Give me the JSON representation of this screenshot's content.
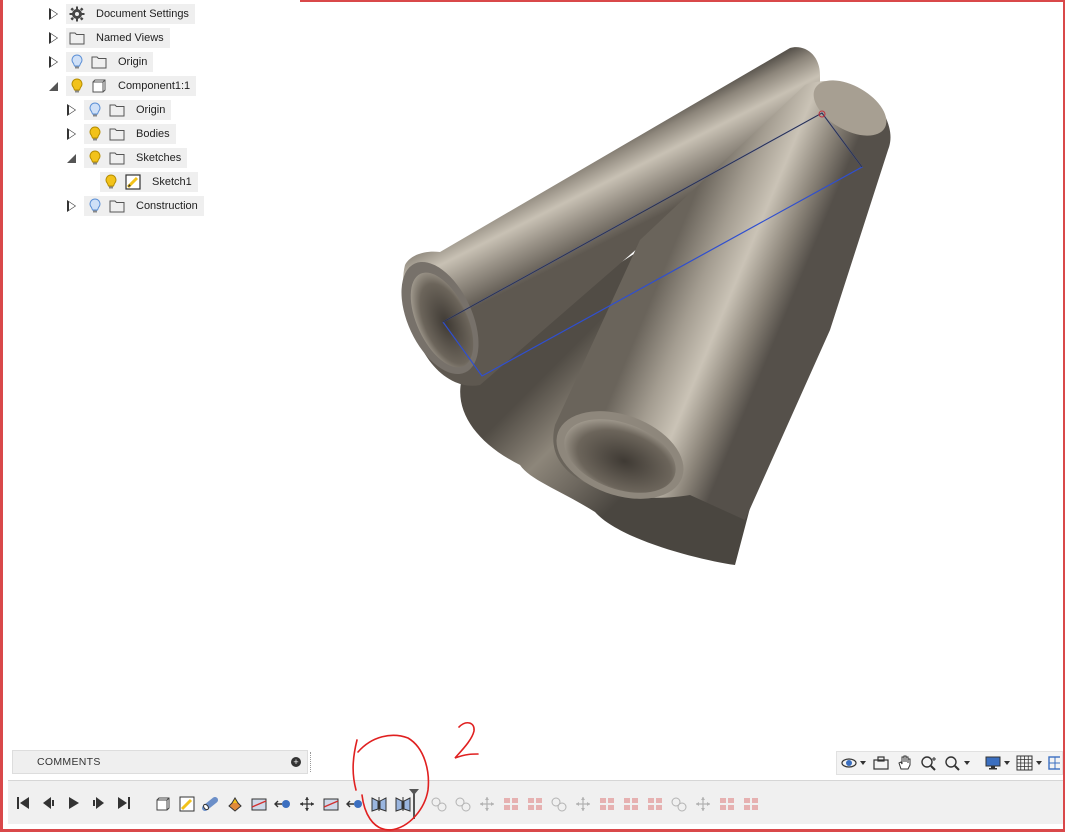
{
  "browser": {
    "items": [
      {
        "label": "Document Settings",
        "icon": "gear-icon"
      },
      {
        "label": "Named Views",
        "icon": "folder-icon"
      },
      {
        "label": "Origin",
        "icon": "folder-icon",
        "visibility": "lightbulb-off-icon"
      },
      {
        "label": "Component1:1",
        "icon": "component-icon",
        "visibility": "lightbulb-on-icon"
      },
      {
        "label": "Origin",
        "icon": "folder-icon",
        "visibility": "lightbulb-off-icon"
      },
      {
        "label": "Bodies",
        "icon": "folder-icon",
        "visibility": "lightbulb-on-icon"
      },
      {
        "label": "Sketches",
        "icon": "folder-icon",
        "visibility": "lightbulb-on-icon"
      },
      {
        "label": "Sketch1",
        "icon": "sketch-icon",
        "visibility": "lightbulb-on-icon"
      },
      {
        "label": "Construction",
        "icon": "folder-icon",
        "visibility": "lightbulb-off-icon"
      }
    ]
  },
  "comments": {
    "label": "COMMENTS"
  },
  "annotations": {
    "one": "1",
    "two": "2"
  },
  "colors": {
    "frame": "#d9484a",
    "lightbulb_on": "#f2c21a",
    "lightbulb_off": "#5b8fd6",
    "sketch_line": "#2f4fd0",
    "annotation": "#e02020",
    "tube": "#8a8278"
  }
}
